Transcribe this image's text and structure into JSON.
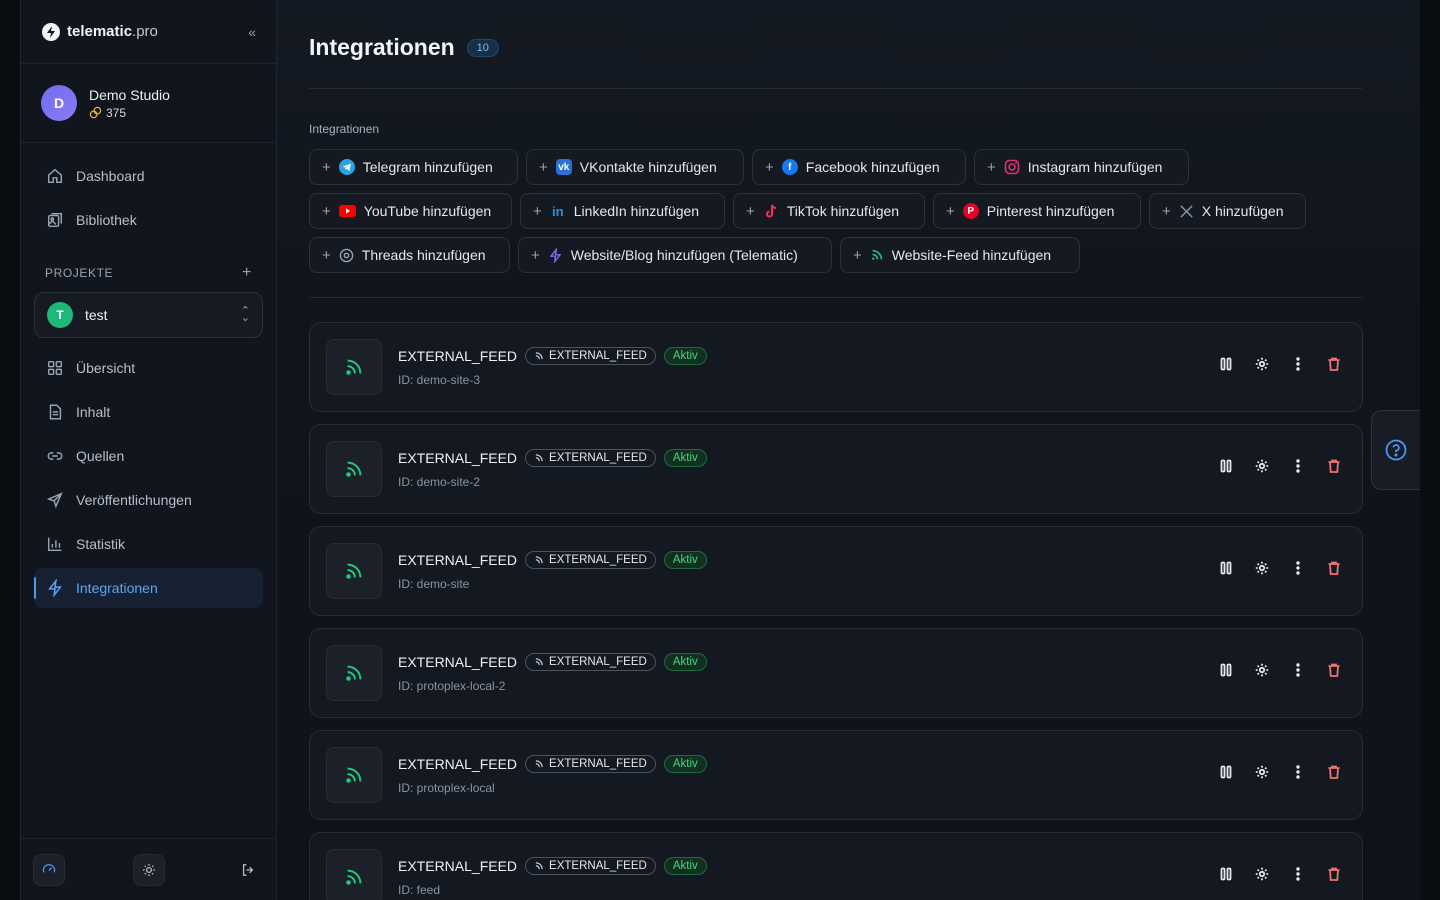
{
  "brand": {
    "name_bold": "telematic",
    "name_light": ".pro"
  },
  "account": {
    "initial": "D",
    "name": "Demo Studio",
    "coins": "375"
  },
  "nav_main": [
    {
      "label": "Dashboard",
      "icon": "home-icon"
    },
    {
      "label": "Bibliothek",
      "icon": "library-icon"
    }
  ],
  "projects": {
    "title": "PROJEKTE",
    "current_initial": "T",
    "current_name": "test"
  },
  "nav_project": [
    {
      "label": "Übersicht",
      "icon": "grid-icon"
    },
    {
      "label": "Inhalt",
      "icon": "document-icon"
    },
    {
      "label": "Quellen",
      "icon": "link-icon"
    },
    {
      "label": "Veröffentlichungen",
      "icon": "send-icon"
    },
    {
      "label": "Statistik",
      "icon": "bar-chart-icon"
    },
    {
      "label": "Integrationen",
      "icon": "bolt-icon",
      "active": true
    }
  ],
  "page": {
    "title": "Integrationen",
    "count": "10",
    "section_label": "Integrationen"
  },
  "add_buttons": {
    "telegram": "Telegram hinzufügen",
    "vkontakte": "VKontakte hinzufügen",
    "facebook": "Facebook hinzufügen",
    "instagram": "Instagram hinzufügen",
    "youtube": "YouTube hinzufügen",
    "linkedin": "LinkedIn hinzufügen",
    "tiktok": "TikTok hinzufügen",
    "pinterest": "Pinterest hinzufügen",
    "x": "X hinzufügen",
    "threads": "Threads hinzufügen",
    "website_blog": "Website/Blog hinzufügen (Telematic)",
    "website_feed": "Website-Feed hinzufügen"
  },
  "integrations": [
    {
      "title": "EXTERNAL_FEED",
      "type": "EXTERNAL_FEED",
      "status": "Aktiv",
      "id": "ID: demo-site-3"
    },
    {
      "title": "EXTERNAL_FEED",
      "type": "EXTERNAL_FEED",
      "status": "Aktiv",
      "id": "ID: demo-site-2"
    },
    {
      "title": "EXTERNAL_FEED",
      "type": "EXTERNAL_FEED",
      "status": "Aktiv",
      "id": "ID: demo-site"
    },
    {
      "title": "EXTERNAL_FEED",
      "type": "EXTERNAL_FEED",
      "status": "Aktiv",
      "id": "ID: protoplex-local-2"
    },
    {
      "title": "EXTERNAL_FEED",
      "type": "EXTERNAL_FEED",
      "status": "Aktiv",
      "id": "ID: protoplex-local"
    },
    {
      "title": "EXTERNAL_FEED",
      "type": "EXTERNAL_FEED",
      "status": "Aktiv",
      "id": "ID: feed"
    }
  ],
  "colors": {
    "accent": "#4c97ef",
    "success": "#22c77e",
    "danger": "#f07171"
  }
}
